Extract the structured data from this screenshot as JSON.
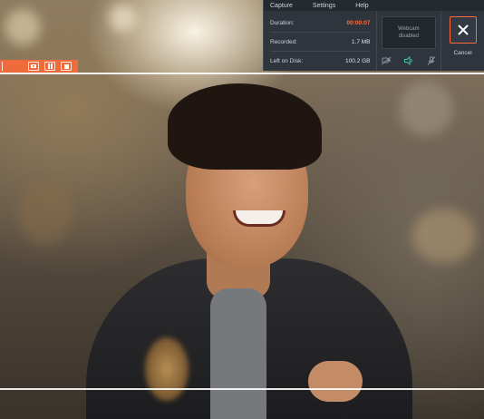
{
  "menu": {
    "items": [
      "Capture",
      "Settings",
      "Help"
    ]
  },
  "stats": {
    "duration_label": "Duration:",
    "duration_value": "00:00:07",
    "recorded_label": "Recorded:",
    "recorded_value": "1.7 MB",
    "disk_label": "Left on Disk:",
    "disk_value": "100.2 GB"
  },
  "webcam": {
    "line1": "Webcam",
    "line2": "disabled"
  },
  "devices": {
    "webcam_icon": "webcam-disabled-icon",
    "speaker_icon": "speaker-icon",
    "microphone_icon": "microphone-disabled-icon"
  },
  "cancel": {
    "label": "Cancel",
    "icon": "close-icon"
  },
  "mini_controls": {
    "icons": [
      "screenshot-camera-icon",
      "pause-icon",
      "stop-icon"
    ]
  },
  "colors": {
    "accent": "#ff6a3d",
    "mini_bar": "#f06b3b",
    "panel_bg": "#2f353d",
    "device_active": "#3fc7a6",
    "device_inactive": "#8b939c"
  }
}
